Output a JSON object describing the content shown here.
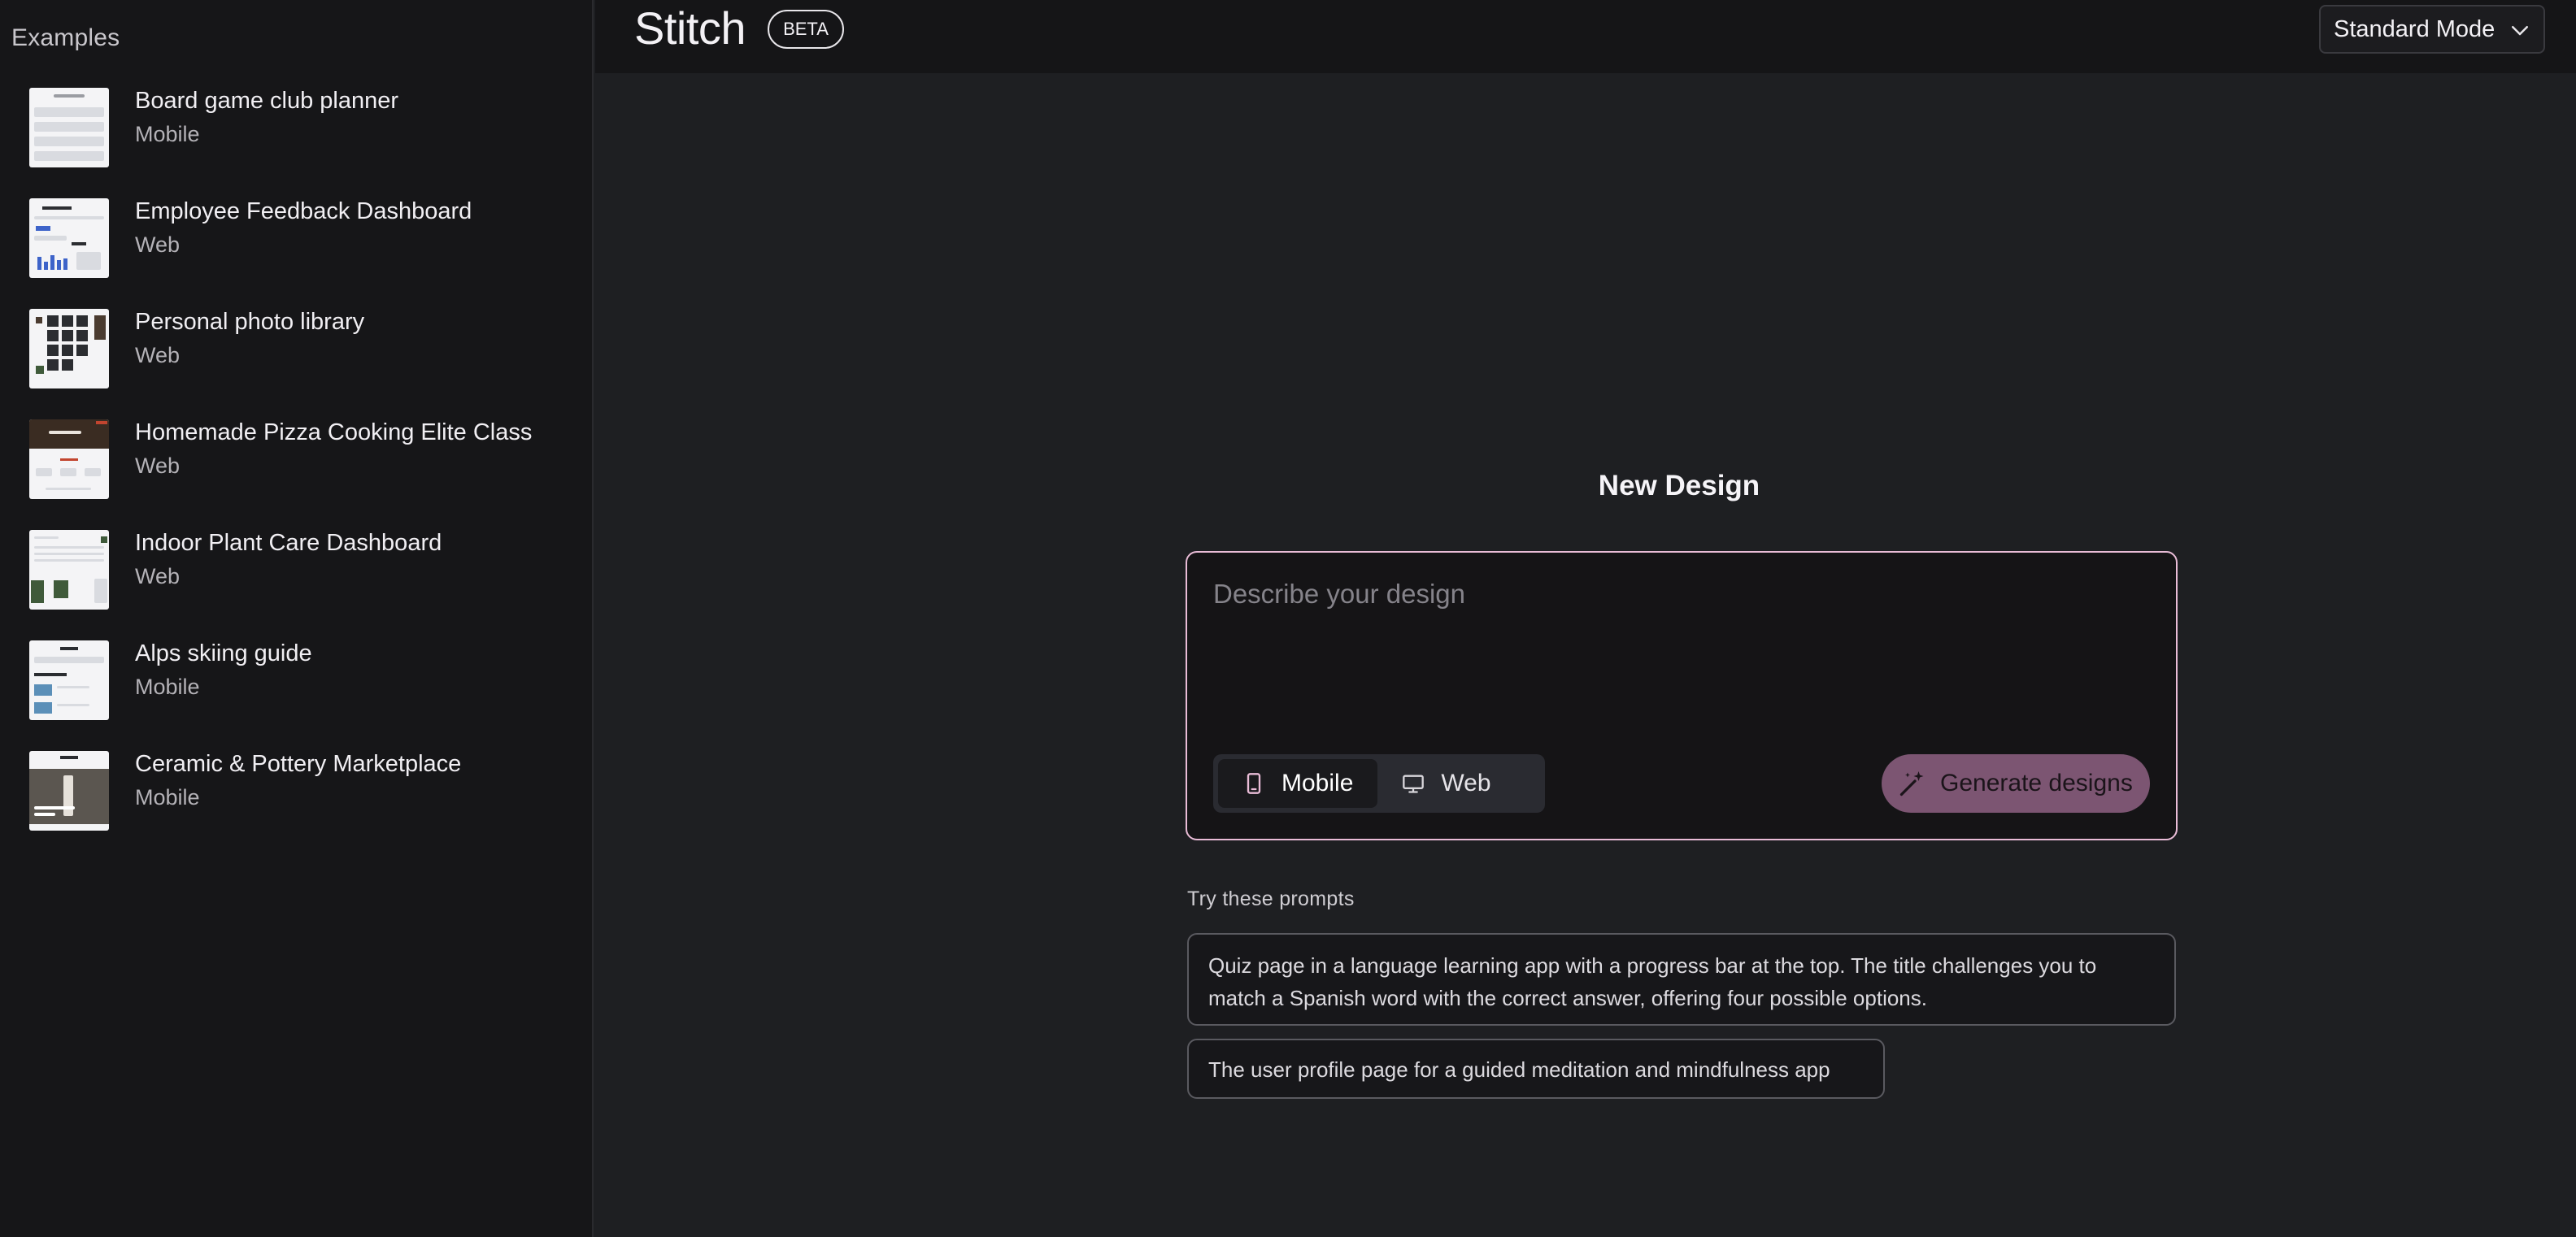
{
  "sidebar": {
    "heading": "Examples",
    "items": [
      {
        "title": "Board game club planner",
        "type": "Mobile"
      },
      {
        "title": "Employee Feedback Dashboard",
        "type": "Web"
      },
      {
        "title": "Personal photo library",
        "type": "Web"
      },
      {
        "title": "Homemade Pizza Cooking Elite Class",
        "type": "Web"
      },
      {
        "title": "Indoor Plant Care Dashboard",
        "type": "Web"
      },
      {
        "title": "Alps skiing guide",
        "type": "Mobile"
      },
      {
        "title": "Ceramic & Pottery Marketplace",
        "type": "Mobile"
      }
    ]
  },
  "header": {
    "logo": "Stitch",
    "badge": "BETA",
    "mode": {
      "selected": "Standard Mode",
      "icon": "chevron-down-icon"
    }
  },
  "main": {
    "title": "New Design",
    "composer": {
      "placeholder": "Describe your design",
      "value": "",
      "platforms": [
        {
          "label": "Mobile",
          "icon": "smartphone-icon",
          "active": true
        },
        {
          "label": "Web",
          "icon": "monitor-icon",
          "active": false
        }
      ],
      "generate_label": "Generate designs",
      "generate_icon": "magic-wand-icon"
    },
    "prompts_heading": "Try these prompts",
    "prompts": [
      "Quiz page in a language learning app with a progress bar at the top. The title challenges you to match a Spanish word with the correct answer, offering four possible options.",
      "The user profile page for a guided meditation and mindfulness app"
    ]
  },
  "colors": {
    "background": "#1e1f22",
    "sidebar": "#161618",
    "accent_border": "#e9bcd7",
    "generate_button": "#7c5572"
  }
}
